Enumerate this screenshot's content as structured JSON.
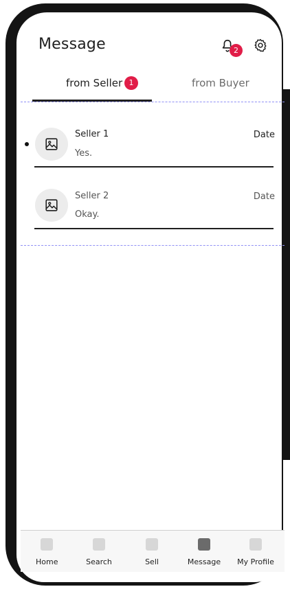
{
  "header": {
    "title": "Message",
    "notifications_count": "2"
  },
  "tabs": [
    {
      "label": "from Seller",
      "badge": "1",
      "active": true
    },
    {
      "label": "from Buyer",
      "active": false
    }
  ],
  "conversations": [
    {
      "name": "Seller 1",
      "message": "Yes.",
      "date": "Date",
      "unread": true
    },
    {
      "name": "Seller 2",
      "message": "Okay.",
      "date": "Date",
      "unread": false
    }
  ],
  "bottom_nav": [
    {
      "label": "Home",
      "icon": "home-icon"
    },
    {
      "label": "Search",
      "icon": "search-icon"
    },
    {
      "label": "Sell",
      "icon": "sell-icon"
    },
    {
      "label": "Message",
      "icon": "message-icon",
      "active": true
    },
    {
      "label": "My Profile",
      "icon": "profile-icon"
    }
  ],
  "colors": {
    "badge": "#e11d48",
    "frame": "#141414",
    "guide": "#8f8ff5"
  }
}
